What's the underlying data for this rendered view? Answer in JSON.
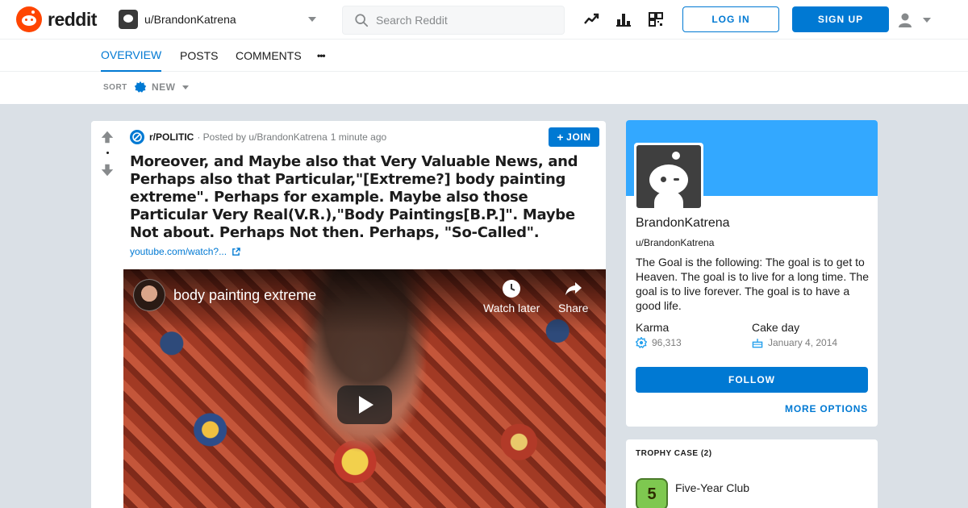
{
  "header": {
    "logo_text": "reddit",
    "profile_switcher": "u/BrandonKatrena",
    "search_placeholder": "Search Reddit",
    "login_label": "LOG IN",
    "signup_label": "SIGN UP",
    "icons": [
      "popular-icon",
      "stats-icon",
      "coins-icon"
    ]
  },
  "tabs": {
    "items": [
      "OVERVIEW",
      "POSTS",
      "COMMENTS"
    ],
    "active": "OVERVIEW",
    "more": "•••"
  },
  "sort": {
    "label": "SORT",
    "value": "NEW"
  },
  "post": {
    "subreddit": "r/POLITIC",
    "posted_by": "· Posted by u/BrandonKatrena",
    "time": "1 minute ago",
    "join_label": "JOIN",
    "title": "Moreover, and Maybe also that Very Valuable News, and Perhaps also that Particular,\"[Extreme?] body painting extreme\". Perhaps for example. Maybe also those Particular Very Real(V.R.),\"Body Paintings[B.P.]\". Maybe Not about. Perhaps Not then. Perhaps, \"So-Called\".",
    "link_text": "youtube.com/watch?...",
    "video": {
      "title": "body painting extreme",
      "watch_later": "Watch later",
      "share": "Share"
    }
  },
  "profile": {
    "display_name": "BrandonKatrena",
    "handle": "u/BrandonKatrena",
    "bio": "The Goal is the following: The goal is to get to Heaven. The goal is to live for a long time. The goal is to live forever. The goal is to have a good life.",
    "karma_label": "Karma",
    "karma_value": "96,313",
    "cakeday_label": "Cake day",
    "cakeday_value": "January 4, 2014",
    "follow_label": "FOLLOW",
    "more_options_label": "MORE OPTIONS"
  },
  "trophy_case": {
    "heading": "TROPHY CASE (2)",
    "items": [
      {
        "name": "Five-Year Club",
        "badge": "5"
      }
    ]
  },
  "colors": {
    "brand": "#ff4500",
    "accent": "#0079d3",
    "banner": "#33a8ff",
    "background": "#dae0e6"
  }
}
